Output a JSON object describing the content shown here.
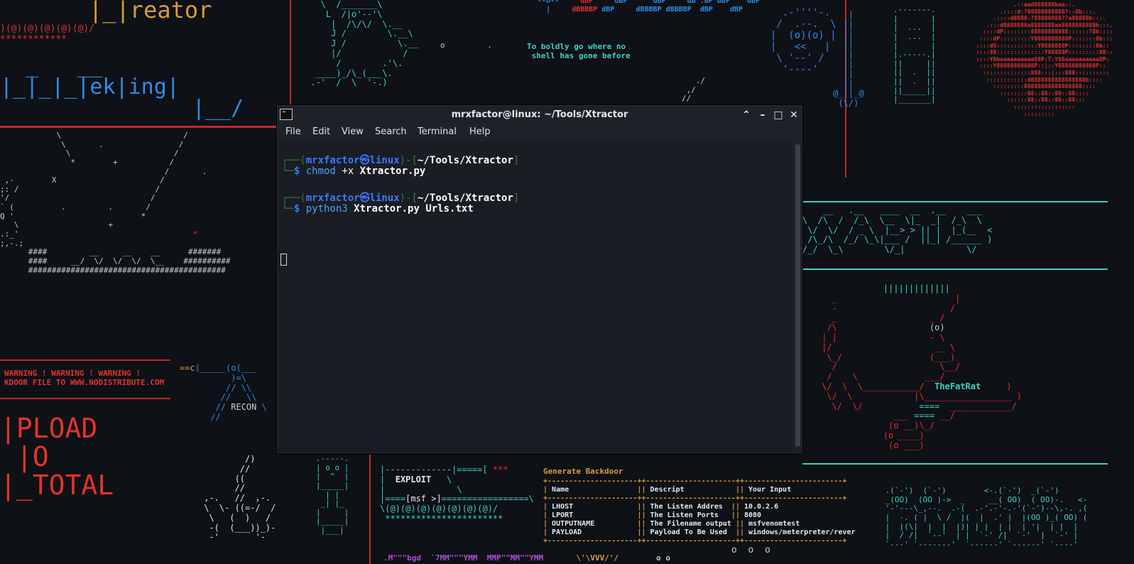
{
  "terminal": {
    "title": "mrxfactor@linux: ~/Tools/Xtractor",
    "menu": [
      "File",
      "Edit",
      "View",
      "Search",
      "Terminal",
      "Help"
    ],
    "prompt_user": "mrxfactor",
    "prompt_at": "㉿",
    "prompt_host": "linux",
    "prompt_path": "~/Tools/Xtractor",
    "commands": [
      {
        "cmd": "chmod",
        "args_plain": "+x",
        "args_bold": "Xtractor.py"
      },
      {
        "cmd": "python3",
        "args_plain": "",
        "args_bold": "Xtractor.py Urls.txt"
      }
    ]
  },
  "wallpaper": {
    "tagline_line1": "To boldly go where no",
    "tagline_line2": "shell has gone before",
    "warning_line1": "WARNING ! WARNING ! WARNING !",
    "warning_line2": "KDOOR FILE TO WWW.NODISTRIBUTE.COM",
    "recon_label": "RECON",
    "fatrat_label": "TheFatRat",
    "exploit_label": "EXPLOIT",
    "msf_label": "[msf >]",
    "backdoor_title": "Generate Backdoor",
    "backdoor_headers": [
      "Name",
      "Descript",
      "Your Input"
    ],
    "backdoor_rows": [
      [
        "LHOST",
        "The Listen Addres",
        "10.0.2.6"
      ],
      [
        "LPORT",
        "The Listen Ports",
        "8080"
      ],
      [
        "OUTPUTNAME",
        "The Filename output",
        "msfvenomtest"
      ],
      [
        "PAYLOAD",
        "Payload To Be Used",
        "windows/meterpreter/rever"
      ]
    ]
  },
  "colors": {
    "red": "#e3322d",
    "teal": "#3fd1c3",
    "orange": "#d99a3e",
    "blue": "#2f8ce6",
    "prompt_blue": "#3b78ff",
    "prompt_green": "#2f7d3c"
  }
}
